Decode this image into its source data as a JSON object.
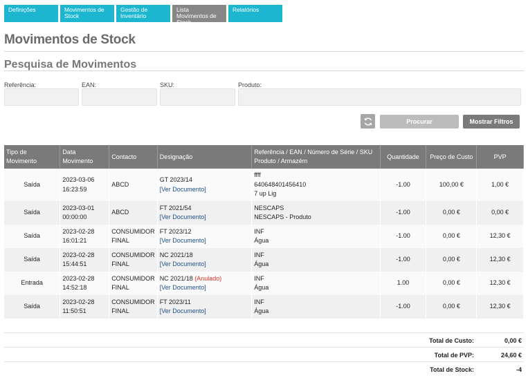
{
  "nav": {
    "tabs": [
      {
        "label": "Definições"
      },
      {
        "label": "Movimentos de Stock"
      },
      {
        "label": "Gestão de Inventário"
      },
      {
        "label": "Lista Movimentos de Stock"
      },
      {
        "label": "Relatórios"
      }
    ],
    "active_tab": "Lista Movimentos de Stock"
  },
  "page_title": "Movimentos de Stock",
  "search": {
    "section_title": "Pesquisa de Movimentos",
    "fields": [
      {
        "label": "Referência:",
        "value": ""
      },
      {
        "label": "EAN:",
        "value": ""
      },
      {
        "label": "SKU:",
        "value": ""
      },
      {
        "label": "Produto:",
        "value": ""
      }
    ],
    "refresh_icon": "refresh-icon",
    "search_label": "Procurar",
    "filters_label": "Mostrar Filtros"
  },
  "table": {
    "headers": {
      "tipo": "Tipo de Movimento",
      "data": "Data Movimento",
      "contacto": "Contacto",
      "designacao": "Designação",
      "ref_1": "Referência / EAN / Número de Série / SKU",
      "ref_2": "Produto / Armazém",
      "quantidade": "Quantidade",
      "custo": "Preço de Custo",
      "pvp": "PVP"
    },
    "rows": [
      {
        "tipo": "Saída",
        "data_1": "2023-03-06",
        "data_2": "16:23:59",
        "contacto_1": "ABCD",
        "contacto_2": "",
        "doc": "GT 2023/14",
        "anulado": "",
        "link": "[Ver Documento]",
        "ref_lines": [
          "ffff",
          "640648401456410",
          "7 up Lig"
        ],
        "qtd": "-1.00",
        "custo": "100,00 €",
        "pvp": "1,00 €"
      },
      {
        "tipo": "Saída",
        "data_1": "2023-03-01",
        "data_2": "00:00:00",
        "contacto_1": "ABCD",
        "contacto_2": "",
        "doc": "FT 2021/54",
        "anulado": "",
        "link": "[Ver Documento]",
        "ref_lines": [
          "NESCAPS",
          "NESCAPS - Produto"
        ],
        "qtd": "-1.00",
        "custo": "0,00 €",
        "pvp": "0,00 €"
      },
      {
        "tipo": "Saída",
        "data_1": "2023-02-28",
        "data_2": "16:01:21",
        "contacto_1": "CONSUMIDOR",
        "contacto_2": "FINAL",
        "doc": "FT 2023/12",
        "anulado": "",
        "link": "[Ver Documento]",
        "ref_lines": [
          "INF",
          "Água"
        ],
        "qtd": "-1.00",
        "custo": "0,00 €",
        "pvp": "12,30 €"
      },
      {
        "tipo": "Saída",
        "data_1": "2023-02-28",
        "data_2": "15:44:51",
        "contacto_1": "CONSUMIDOR",
        "contacto_2": "FINAL",
        "doc": "NC 2021/18",
        "anulado": "",
        "link": "[Ver Documento]",
        "ref_lines": [
          "INF",
          "Água"
        ],
        "qtd": "-1.00",
        "custo": "0,00 €",
        "pvp": "12,30 €"
      },
      {
        "tipo": "Entrada",
        "data_1": "2023-02-28",
        "data_2": "14:52:18",
        "contacto_1": "CONSUMIDOR",
        "contacto_2": "FINAL",
        "doc": "NC 2021/18",
        "anulado": "(Anulado)",
        "link": "[Ver Documento]",
        "ref_lines": [
          "INF",
          "Água"
        ],
        "qtd": "1.00",
        "custo": "0,00 €",
        "pvp": "12,30 €"
      },
      {
        "tipo": "Saída",
        "data_1": "2023-02-28",
        "data_2": "11:50:51",
        "contacto_1": "CONSUMIDOR",
        "contacto_2": "FINAL",
        "doc": "FT 2023/11",
        "anulado": "",
        "link": "[Ver Documento]",
        "ref_lines": [
          "INF",
          "Água"
        ],
        "qtd": "-1.00",
        "custo": "0,00 €",
        "pvp": "12,30 €"
      }
    ]
  },
  "totals": [
    {
      "label": "Total de Custo:",
      "value": "0,00 €"
    },
    {
      "label": "Total de PVP:",
      "value": "24,60 €"
    },
    {
      "label": "Total de Stock:",
      "value": "-4"
    }
  ],
  "colors": {
    "tab": "#1cb6d1",
    "tab_active": "#878787",
    "header": "#7a7a7a",
    "link": "#1e4f86",
    "anulado": "#d9362b"
  }
}
